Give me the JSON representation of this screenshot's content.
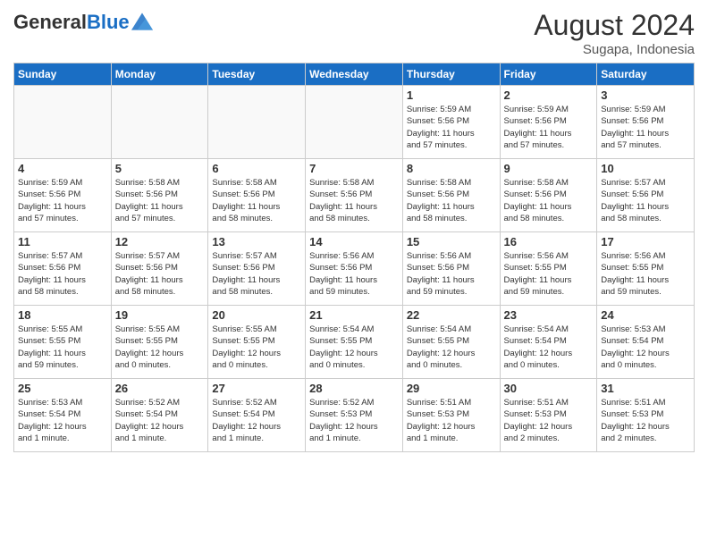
{
  "header": {
    "logo_general": "General",
    "logo_blue": "Blue",
    "month_year": "August 2024",
    "location": "Sugapa, Indonesia"
  },
  "days_of_week": [
    "Sunday",
    "Monday",
    "Tuesday",
    "Wednesday",
    "Thursday",
    "Friday",
    "Saturday"
  ],
  "weeks": [
    [
      {
        "day": "",
        "info": ""
      },
      {
        "day": "",
        "info": ""
      },
      {
        "day": "",
        "info": ""
      },
      {
        "day": "",
        "info": ""
      },
      {
        "day": "1",
        "info": "Sunrise: 5:59 AM\nSunset: 5:56 PM\nDaylight: 11 hours\nand 57 minutes."
      },
      {
        "day": "2",
        "info": "Sunrise: 5:59 AM\nSunset: 5:56 PM\nDaylight: 11 hours\nand 57 minutes."
      },
      {
        "day": "3",
        "info": "Sunrise: 5:59 AM\nSunset: 5:56 PM\nDaylight: 11 hours\nand 57 minutes."
      }
    ],
    [
      {
        "day": "4",
        "info": "Sunrise: 5:59 AM\nSunset: 5:56 PM\nDaylight: 11 hours\nand 57 minutes."
      },
      {
        "day": "5",
        "info": "Sunrise: 5:58 AM\nSunset: 5:56 PM\nDaylight: 11 hours\nand 57 minutes."
      },
      {
        "day": "6",
        "info": "Sunrise: 5:58 AM\nSunset: 5:56 PM\nDaylight: 11 hours\nand 58 minutes."
      },
      {
        "day": "7",
        "info": "Sunrise: 5:58 AM\nSunset: 5:56 PM\nDaylight: 11 hours\nand 58 minutes."
      },
      {
        "day": "8",
        "info": "Sunrise: 5:58 AM\nSunset: 5:56 PM\nDaylight: 11 hours\nand 58 minutes."
      },
      {
        "day": "9",
        "info": "Sunrise: 5:58 AM\nSunset: 5:56 PM\nDaylight: 11 hours\nand 58 minutes."
      },
      {
        "day": "10",
        "info": "Sunrise: 5:57 AM\nSunset: 5:56 PM\nDaylight: 11 hours\nand 58 minutes."
      }
    ],
    [
      {
        "day": "11",
        "info": "Sunrise: 5:57 AM\nSunset: 5:56 PM\nDaylight: 11 hours\nand 58 minutes."
      },
      {
        "day": "12",
        "info": "Sunrise: 5:57 AM\nSunset: 5:56 PM\nDaylight: 11 hours\nand 58 minutes."
      },
      {
        "day": "13",
        "info": "Sunrise: 5:57 AM\nSunset: 5:56 PM\nDaylight: 11 hours\nand 58 minutes."
      },
      {
        "day": "14",
        "info": "Sunrise: 5:56 AM\nSunset: 5:56 PM\nDaylight: 11 hours\nand 59 minutes."
      },
      {
        "day": "15",
        "info": "Sunrise: 5:56 AM\nSunset: 5:56 PM\nDaylight: 11 hours\nand 59 minutes."
      },
      {
        "day": "16",
        "info": "Sunrise: 5:56 AM\nSunset: 5:55 PM\nDaylight: 11 hours\nand 59 minutes."
      },
      {
        "day": "17",
        "info": "Sunrise: 5:56 AM\nSunset: 5:55 PM\nDaylight: 11 hours\nand 59 minutes."
      }
    ],
    [
      {
        "day": "18",
        "info": "Sunrise: 5:55 AM\nSunset: 5:55 PM\nDaylight: 11 hours\nand 59 minutes."
      },
      {
        "day": "19",
        "info": "Sunrise: 5:55 AM\nSunset: 5:55 PM\nDaylight: 12 hours\nand 0 minutes."
      },
      {
        "day": "20",
        "info": "Sunrise: 5:55 AM\nSunset: 5:55 PM\nDaylight: 12 hours\nand 0 minutes."
      },
      {
        "day": "21",
        "info": "Sunrise: 5:54 AM\nSunset: 5:55 PM\nDaylight: 12 hours\nand 0 minutes."
      },
      {
        "day": "22",
        "info": "Sunrise: 5:54 AM\nSunset: 5:55 PM\nDaylight: 12 hours\nand 0 minutes."
      },
      {
        "day": "23",
        "info": "Sunrise: 5:54 AM\nSunset: 5:54 PM\nDaylight: 12 hours\nand 0 minutes."
      },
      {
        "day": "24",
        "info": "Sunrise: 5:53 AM\nSunset: 5:54 PM\nDaylight: 12 hours\nand 0 minutes."
      }
    ],
    [
      {
        "day": "25",
        "info": "Sunrise: 5:53 AM\nSunset: 5:54 PM\nDaylight: 12 hours\nand 1 minute."
      },
      {
        "day": "26",
        "info": "Sunrise: 5:52 AM\nSunset: 5:54 PM\nDaylight: 12 hours\nand 1 minute."
      },
      {
        "day": "27",
        "info": "Sunrise: 5:52 AM\nSunset: 5:54 PM\nDaylight: 12 hours\nand 1 minute."
      },
      {
        "day": "28",
        "info": "Sunrise: 5:52 AM\nSunset: 5:53 PM\nDaylight: 12 hours\nand 1 minute."
      },
      {
        "day": "29",
        "info": "Sunrise: 5:51 AM\nSunset: 5:53 PM\nDaylight: 12 hours\nand 1 minute."
      },
      {
        "day": "30",
        "info": "Sunrise: 5:51 AM\nSunset: 5:53 PM\nDaylight: 12 hours\nand 2 minutes."
      },
      {
        "day": "31",
        "info": "Sunrise: 5:51 AM\nSunset: 5:53 PM\nDaylight: 12 hours\nand 2 minutes."
      }
    ]
  ]
}
